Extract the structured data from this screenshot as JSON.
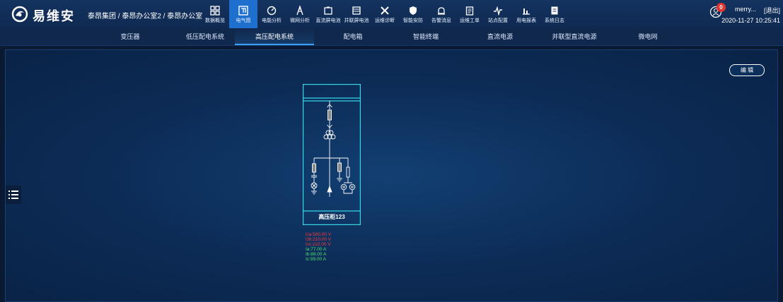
{
  "header": {
    "brand": "易维安",
    "breadcrumb": "泰昂集团 / 泰昂办公室2 / 泰昂办公室",
    "nav": [
      {
        "label": "数据概览",
        "icon": "grid-icon",
        "active": false
      },
      {
        "label": "电气图",
        "icon": "diagram-icon",
        "active": true
      },
      {
        "label": "电能分析",
        "icon": "gauge-icon",
        "active": false
      },
      {
        "label": "微网分析",
        "icon": "tower-icon",
        "active": false
      },
      {
        "label": "直流屏电池",
        "icon": "battery-icon",
        "active": false
      },
      {
        "label": "并联屏电池",
        "icon": "battery-pack-icon",
        "active": false
      },
      {
        "label": "运维诊断",
        "icon": "tools-icon",
        "active": false
      },
      {
        "label": "智能安防",
        "icon": "shield-icon",
        "active": false
      },
      {
        "label": "告警消息",
        "icon": "alarm-icon",
        "active": false
      },
      {
        "label": "运维工单",
        "icon": "clipboard-icon",
        "active": false
      },
      {
        "label": "站点配置",
        "icon": "pulse-icon",
        "active": false
      },
      {
        "label": "用电报表",
        "icon": "bar-chart-icon",
        "active": false
      },
      {
        "label": "系统日志",
        "icon": "log-icon",
        "active": false
      }
    ],
    "notification_count": "0",
    "username": "merry...",
    "logout_label": "[退出]",
    "datetime": "2020-11-27 10:25:41"
  },
  "tabs": [
    {
      "label": "变压器",
      "active": false
    },
    {
      "label": "低压配电系统",
      "active": false
    },
    {
      "label": "高压配电系统",
      "active": true
    },
    {
      "label": "配电箱",
      "active": false
    },
    {
      "label": "智能终端",
      "active": false
    },
    {
      "label": "直流电源",
      "active": false
    },
    {
      "label": "并联型直流电源",
      "active": false
    },
    {
      "label": "微电网",
      "active": false
    }
  ],
  "main": {
    "edit_label": "编 辑",
    "cabinet_name": "高压柜123",
    "readings": [
      {
        "text": "Ua:500.00 V",
        "color": "#ff3b3b"
      },
      {
        "text": "Ub:210.00 V",
        "color": "#ff3b3b"
      },
      {
        "text": "Uc:222.00 V",
        "color": "#ff3b3b"
      },
      {
        "text": "Ia:77.00 A",
        "color": "#4ee06a"
      },
      {
        "text": "Ib:88.00 A",
        "color": "#4ee06a"
      },
      {
        "text": "Ic:99.00 A",
        "color": "#4ee06a"
      }
    ]
  },
  "colors": {
    "accent": "#1f6fcf",
    "cabinet_outline": "#35d6e6",
    "alert": "#e3342f"
  }
}
